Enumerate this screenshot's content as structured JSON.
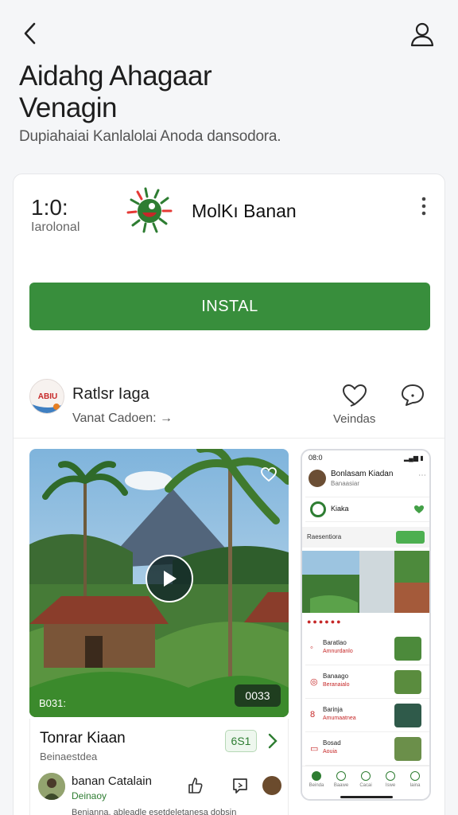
{
  "header": {
    "back_icon": "chevron-left-icon",
    "profile_icon": "user-icon",
    "title_line1": "Aidahg Ahagaar",
    "title_line2": "Venagin",
    "subtitle": "Dupiahaiai Kanlalolai Anoda dansodora."
  },
  "app_card": {
    "time": "1:0:",
    "time_sub": "Iarolonal",
    "app_name": "MolKı Banan",
    "install_label": "INSTAL",
    "colors": {
      "install_bg": "#388e3c",
      "accent_red": "#c62828"
    }
  },
  "developer": {
    "avatar_text": "ABIU",
    "name": "Ratlsr Iaga",
    "link_text": "Vanat Cadoen:",
    "react_label": "Veindas"
  },
  "media_card": {
    "time_left": "B031:",
    "time_right": "0033",
    "title": "Tonrar Kiaan",
    "subtitle": "Beinaestdea",
    "badge": "6S1",
    "user_name": "banan Catalain",
    "user_sub": "Deinaoy",
    "user_desc": "Benianna, ableadle esetdeletanesa dobsin"
  },
  "phone": {
    "status_time": "08:0",
    "status_icons": "▂▄▆ ▮",
    "header_title": "Bonlasam Kiadan",
    "header_sub": "Banaasiar",
    "app_row": "Kiaka",
    "section_title": "Raesentiora",
    "list": [
      {
        "title": "Baratlao",
        "sub": "Amnurdanlo",
        "icon": "◦"
      },
      {
        "title": "Banaago",
        "sub": "Beranaialo",
        "icon": "◎"
      },
      {
        "title": "Barinja",
        "sub": "Amumaatnea",
        "icon": "8"
      },
      {
        "title": "Bosad",
        "sub": "Aouia",
        "icon": "▭"
      }
    ],
    "nav": [
      "Beinda",
      "Baawe",
      "Cacai",
      "Iswe",
      "Iaina"
    ]
  }
}
